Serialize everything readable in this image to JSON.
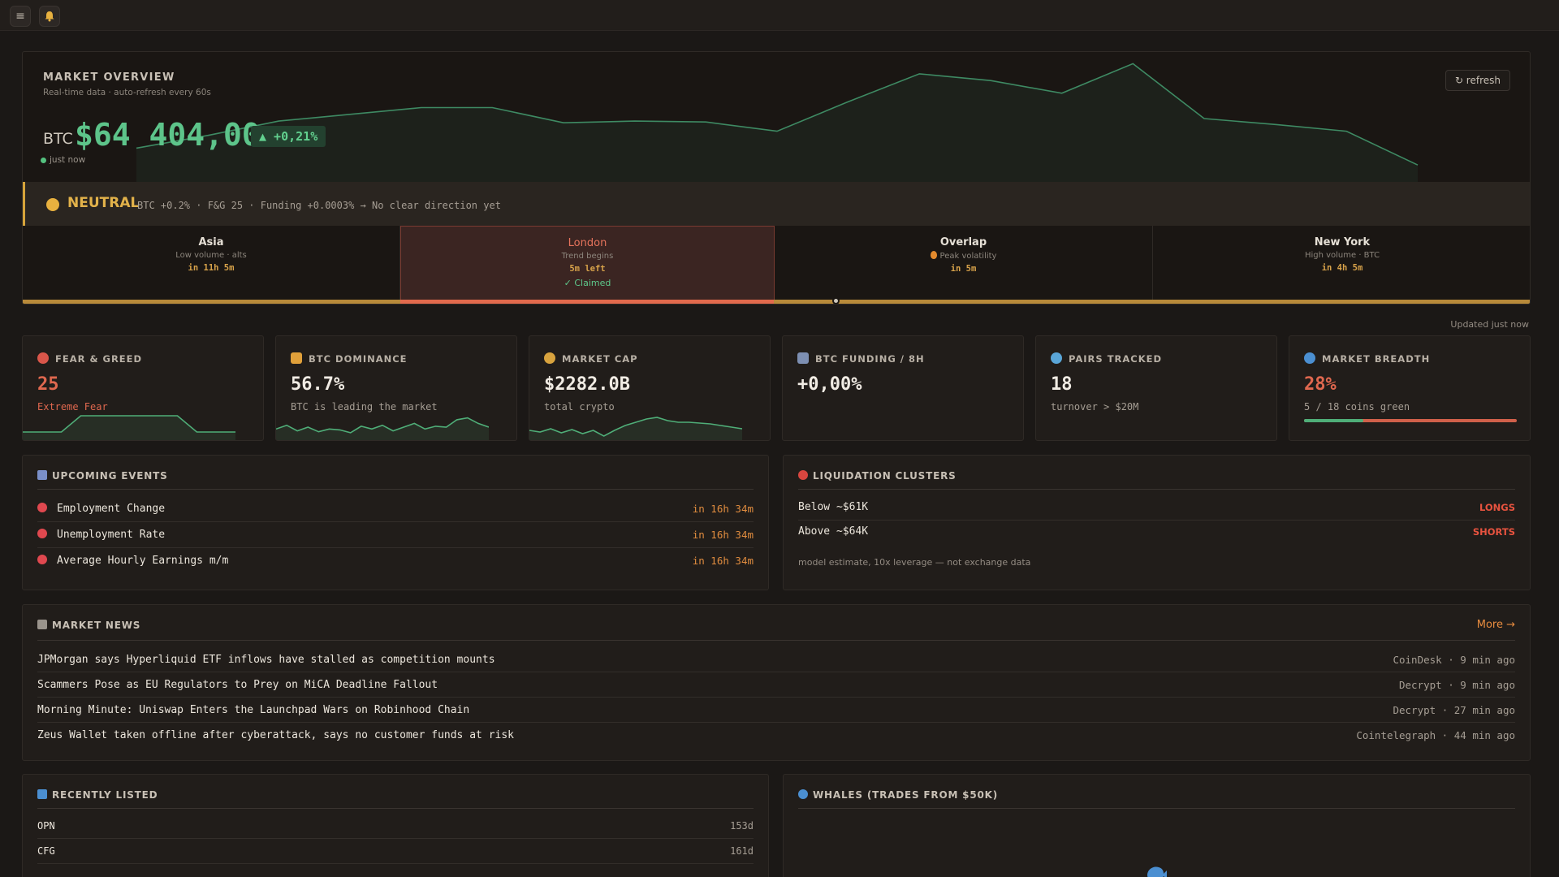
{
  "topbar": {
    "menu_icon": "≡",
    "bell_icon": "bell"
  },
  "overview": {
    "title": "MARKET OVERVIEW",
    "subtitle": "Real-time data · auto-refresh every 60s",
    "symbol": "BTC",
    "price": "$64 404,00",
    "change": "▲ +0,21%",
    "updated": "just now",
    "refresh_label": "↻ refresh",
    "sparkline": [
      40,
      55,
      72,
      80,
      88,
      88,
      70,
      72,
      71,
      60,
      95,
      128,
      120,
      105,
      140,
      75,
      68,
      60,
      20
    ],
    "colors": {
      "up": "#5dc48a",
      "accent": "#d6a43a"
    }
  },
  "sentiment": {
    "label": "NEUTRAL",
    "text": "BTC +0.2% · F&G 25 · Funding +0.0003% → No clear direction yet"
  },
  "sessions": [
    {
      "name": "Asia",
      "desc": "Low volume · alts",
      "time": "in 11h 5m"
    },
    {
      "name": "London",
      "desc": "Trend begins",
      "time": "5m left",
      "status": "✓ Claimed",
      "active": true
    },
    {
      "name": "Overlap",
      "desc": "Peak volatility",
      "time": "in 5m"
    },
    {
      "name": "New York",
      "desc": "High volume · BTC",
      "time": "in 4h 5m"
    }
  ],
  "updated_label": "Updated just now",
  "stats": {
    "fear": {
      "title": "FEAR & GREED",
      "value": "25",
      "sub": "Extreme Fear",
      "spark": [
        10,
        10,
        10,
        30,
        30,
        30,
        30,
        30,
        30,
        10,
        10,
        10
      ]
    },
    "dominance": {
      "title": "BTC DOMINANCE",
      "value": "56.7%",
      "sub": "BTC is leading the market",
      "spark": [
        12,
        16,
        10,
        14,
        9,
        12,
        11,
        8,
        15,
        12,
        16,
        10,
        14,
        18,
        12,
        15,
        14,
        22,
        24,
        18,
        14
      ]
    },
    "mcap": {
      "title": "MARKET CAP",
      "value": "$2282.0B",
      "sub": "total crypto",
      "spark": [
        12,
        10,
        14,
        9,
        13,
        8,
        12,
        5,
        12,
        18,
        22,
        26,
        28,
        24,
        22,
        22,
        21,
        20,
        18,
        16,
        14
      ]
    },
    "funding": {
      "title": "BTC FUNDING / 8H",
      "value": "+0,00%"
    },
    "pairs": {
      "title": "PAIRS TRACKED",
      "value": "18",
      "sub": "turnover > $20M"
    },
    "breadth": {
      "title": "MARKET BREADTH",
      "value": "28%",
      "sub": "5 / 18 coins green",
      "green_fraction": 0.28
    }
  },
  "events": {
    "title": "UPCOMING EVENTS",
    "items": [
      {
        "name": "Employment Change",
        "time": "in 16h 34m"
      },
      {
        "name": "Unemployment Rate",
        "time": "in 16h 34m"
      },
      {
        "name": "Average Hourly Earnings m/m",
        "time": "in 16h 34m"
      }
    ]
  },
  "liquidations": {
    "title": "LIQUIDATION CLUSTERS",
    "items": [
      {
        "level": "Below ~$61K",
        "side": "LONGS"
      },
      {
        "level": "Above ~$64K",
        "side": "SHORTS"
      }
    ],
    "note": "model estimate, 10x leverage — not exchange data"
  },
  "news": {
    "title": "MARKET NEWS",
    "more": "More →",
    "items": [
      {
        "headline": "JPMorgan says Hyperliquid ETF inflows have stalled as competition mounts",
        "meta": "CoinDesk · 9 min ago"
      },
      {
        "headline": "Scammers Pose as EU Regulators to Prey on MiCA Deadline Fallout",
        "meta": "Decrypt · 9 min ago"
      },
      {
        "headline": "Morning Minute: Uniswap Enters the Launchpad Wars on Robinhood Chain",
        "meta": "Decrypt · 27 min ago"
      },
      {
        "headline": "Zeus Wallet taken offline after cyberattack, says no customer funds at risk",
        "meta": "Cointelegraph · 44 min ago"
      }
    ]
  },
  "listed": {
    "title": "RECENTLY LISTED",
    "items": [
      {
        "symbol": "OPN",
        "age": "153d"
      },
      {
        "symbol": "CFG",
        "age": "161d"
      }
    ]
  },
  "whales": {
    "title": "WHALES (TRADES FROM $50K)"
  }
}
